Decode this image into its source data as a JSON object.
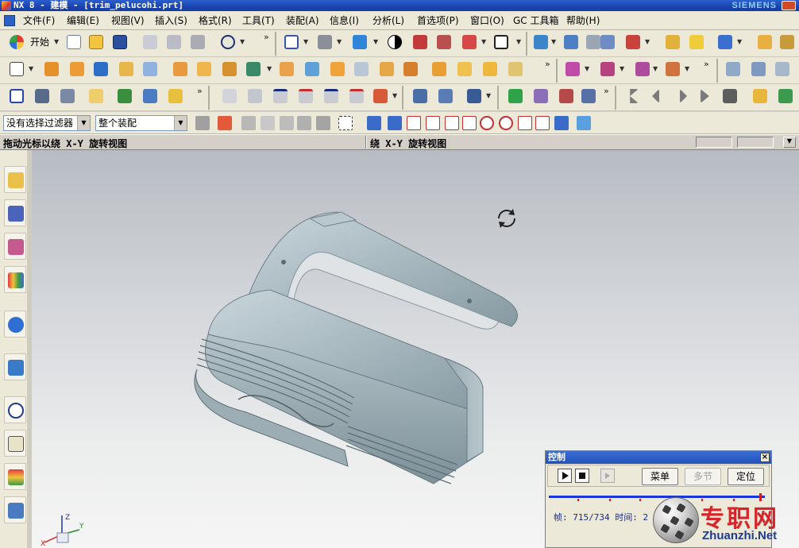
{
  "window": {
    "title": "NX 8 - 建模 - [trim_pelucohi.prt]",
    "brand": "SIEMENS"
  },
  "menu": [
    "文件(F)",
    "编辑(E)",
    "视图(V)",
    "插入(S)",
    "格式(R)",
    "工具(T)",
    "装配(A)",
    "信息(I)",
    "分析(L)",
    "首选项(P)",
    "窗口(O)",
    "GC 工具箱",
    "帮助(H)"
  ],
  "toolbar": {
    "start_label": "开始",
    "filter_label": "没有选择过滤器",
    "scope_label": "整个装配"
  },
  "cue_line": {
    "prompt": "拖动光标以绕 X-Y 旋转视图",
    "status": "绕 X-Y 旋转视图"
  },
  "colors": {
    "accent": "#2251b8",
    "model": "#a5b6bd",
    "watermark_red": "#d6252b",
    "watermark_blue": "#1f3b8f"
  },
  "icons": {
    "rotate_cursor": "rotate-cursor-icon",
    "triad": "wcs-triad-icon"
  },
  "triad": {
    "x_label": "X",
    "y_label": "Y",
    "z_label": "Z"
  },
  "control_dialog": {
    "title": "控制",
    "menu_button": "菜单",
    "step_button": "多节",
    "position_button": "定位",
    "frame_text": "帧: 715/734 时间: 2",
    "progress": 0.974
  },
  "watermark": {
    "chinese": "专职网",
    "english": "Zhuanzhi.Net"
  }
}
